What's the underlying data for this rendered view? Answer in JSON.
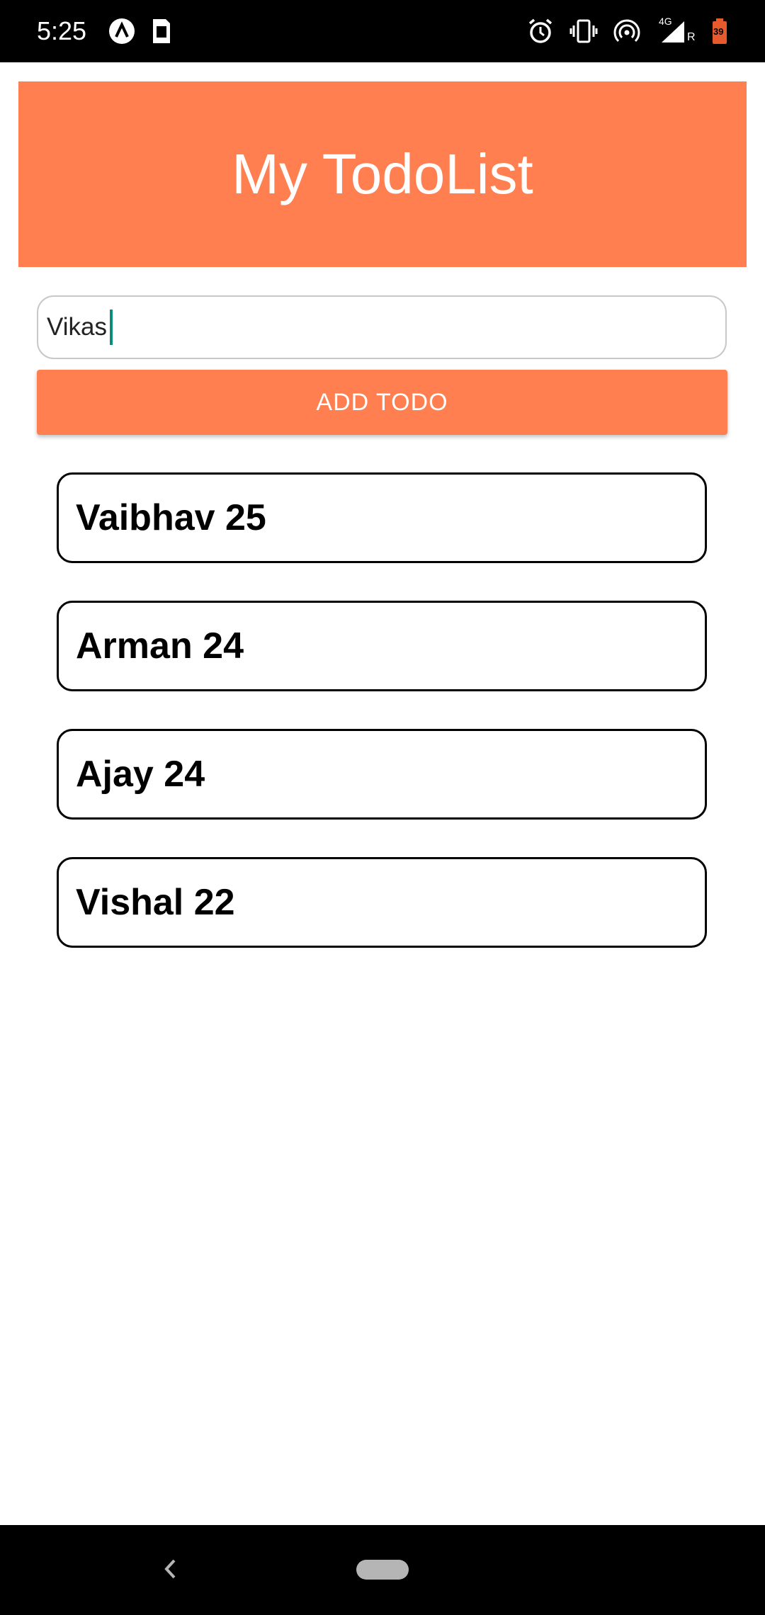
{
  "status_bar": {
    "time": "5:25",
    "left_icons": [
      "app-notification-icon",
      "sim-card-icon"
    ],
    "right_icons": [
      "alarm-icon",
      "vibrate-icon",
      "hotspot-icon",
      "signal-4g-icon",
      "battery-icon"
    ],
    "network_label": "4G",
    "roaming_label": "R",
    "battery_level": "39"
  },
  "header": {
    "title": "My TodoList",
    "background_color": "#ff7f50"
  },
  "todo_input": {
    "value": "Vikas",
    "placeholder": ""
  },
  "add_button": {
    "label": "ADD TODO"
  },
  "todos": [
    {
      "text": "Vaibhav 25"
    },
    {
      "text": "Arman 24"
    },
    {
      "text": "Ajay 24"
    },
    {
      "text": "Vishal 22"
    }
  ],
  "nav_bar": {
    "icons": [
      "back-icon",
      "home-pill-icon"
    ]
  }
}
